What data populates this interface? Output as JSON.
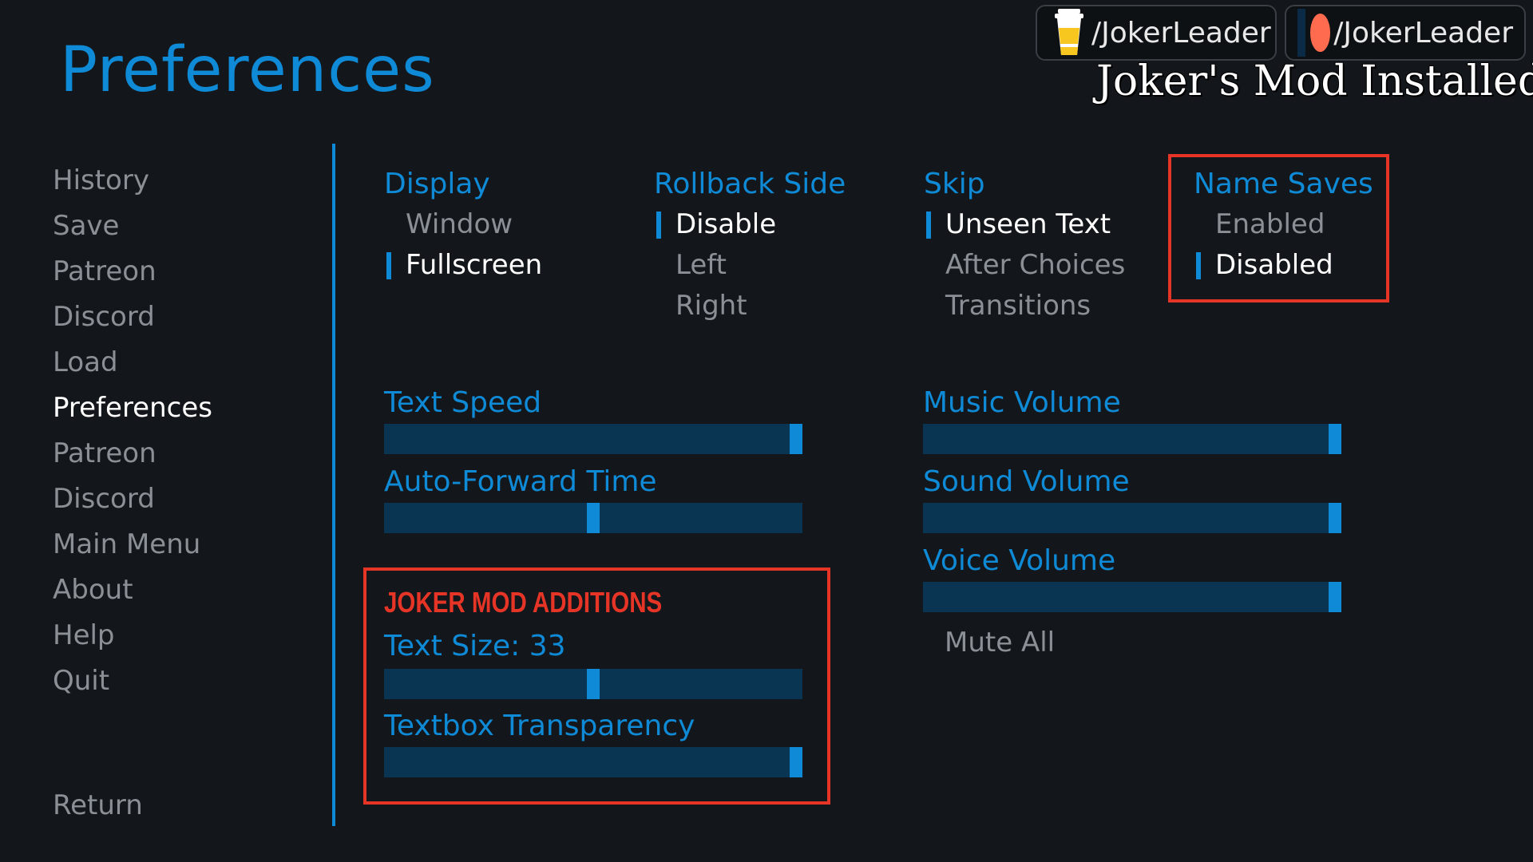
{
  "page_title": "Preferences",
  "badges": {
    "patreon_text": "/JokerLeader",
    "discord_text": "/JokerLeader"
  },
  "mod_installed": "Joker's Mod Installed",
  "nav": [
    "History",
    "Save",
    "Patreon",
    "Discord",
    "Load",
    "Preferences",
    "Patreon",
    "Discord",
    "Main Menu",
    "About",
    "Help",
    "Quit"
  ],
  "nav_active_index": 5,
  "nav_return": "Return",
  "display": {
    "title": "Display",
    "options": [
      "Window",
      "Fullscreen"
    ],
    "selected": "Fullscreen"
  },
  "rollback": {
    "title": "Rollback Side",
    "options": [
      "Disable",
      "Left",
      "Right"
    ],
    "selected": "Disable"
  },
  "skip": {
    "title": "Skip",
    "options": [
      "Unseen Text",
      "After Choices",
      "Transitions"
    ],
    "selected": "Unseen Text"
  },
  "name_saves": {
    "title": "Name Saves",
    "options": [
      "Enabled",
      "Disabled"
    ],
    "selected": "Disabled"
  },
  "sliders": {
    "text_speed": {
      "label": "Text Speed",
      "value": 0.99
    },
    "auto_forward": {
      "label": "Auto-Forward Time",
      "value": 0.5
    },
    "music_volume": {
      "label": "Music Volume",
      "value": 0.99
    },
    "sound_volume": {
      "label": "Sound Volume",
      "value": 0.99
    },
    "voice_volume": {
      "label": "Voice Volume",
      "value": 0.99
    }
  },
  "mute_all": "Mute All",
  "mod": {
    "heading": "JOKER MOD ADDITIONS",
    "text_size": {
      "label": "Text Size: 33",
      "value": 0.5
    },
    "textbox_transparency": {
      "label": "Textbox Transparency",
      "value": 0.99
    }
  },
  "colors": {
    "accent": "#0f8ad6",
    "highlight_box": "#e63526",
    "background": "#13171b",
    "slider_track": "#0a3552"
  }
}
